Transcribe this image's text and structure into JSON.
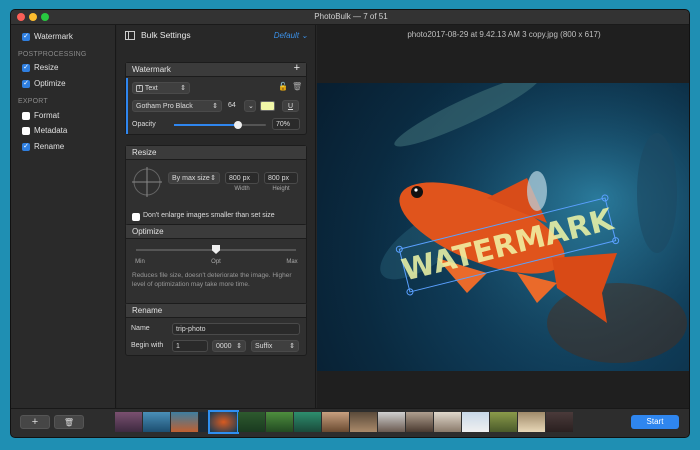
{
  "window": {
    "title": "PhotoBulk — 7 of 51"
  },
  "sidebar": {
    "watermark": {
      "label": "Watermark",
      "checked": true
    },
    "postprocessing_header": "POSTPROCESSING",
    "resize": {
      "label": "Resize",
      "checked": true
    },
    "optimize": {
      "label": "Optimize",
      "checked": true
    },
    "export_header": "EXPORT",
    "format": {
      "label": "Format",
      "checked": false
    },
    "metadata": {
      "label": "Metadata",
      "checked": false
    },
    "rename": {
      "label": "Rename",
      "checked": true
    }
  },
  "settings": {
    "title": "Bulk Settings",
    "preset": "Default",
    "watermark": {
      "title": "Watermark",
      "add_symbol": "+",
      "type": "Text",
      "font": "Gotham Pro Black",
      "size": "64",
      "underline_symbol": "U",
      "opacity_label": "Opacity",
      "opacity_value": "70%",
      "opacity_fraction": 0.7,
      "swatch_color": "#f2f8a8"
    },
    "resize": {
      "title": "Resize",
      "mode": "By max size",
      "width": "800 px",
      "height": "800 px",
      "width_label": "Width",
      "height_label": "Height",
      "dont_enlarge_label": "Don't enlarge images smaller than set size",
      "dont_enlarge_checked": false
    },
    "optimize": {
      "title": "Optimize",
      "min_label": "Min",
      "opt_label": "Opt",
      "max_label": "Max",
      "level_fraction": 0.5,
      "desc": "Reduces file size, doesn't deteriorate the image. Higher level of optimization may take more time."
    },
    "rename": {
      "title": "Rename",
      "name_label": "Name",
      "name_value": "trip-photo",
      "begin_label": "Begin with",
      "begin_value": "1",
      "digits": "0000",
      "position": "Suffix"
    }
  },
  "preview": {
    "filename": "photo2017-08-29 at 9.42.13 AM 3 copy.jpg (800 x 617)",
    "watermark_text": "WATERMARK"
  },
  "bottom": {
    "add_symbol": "+",
    "start_label": "Start"
  },
  "colors": {
    "accent": "#2f86ef",
    "fish": "#e0541c",
    "watermark": "#f2f8a8"
  }
}
